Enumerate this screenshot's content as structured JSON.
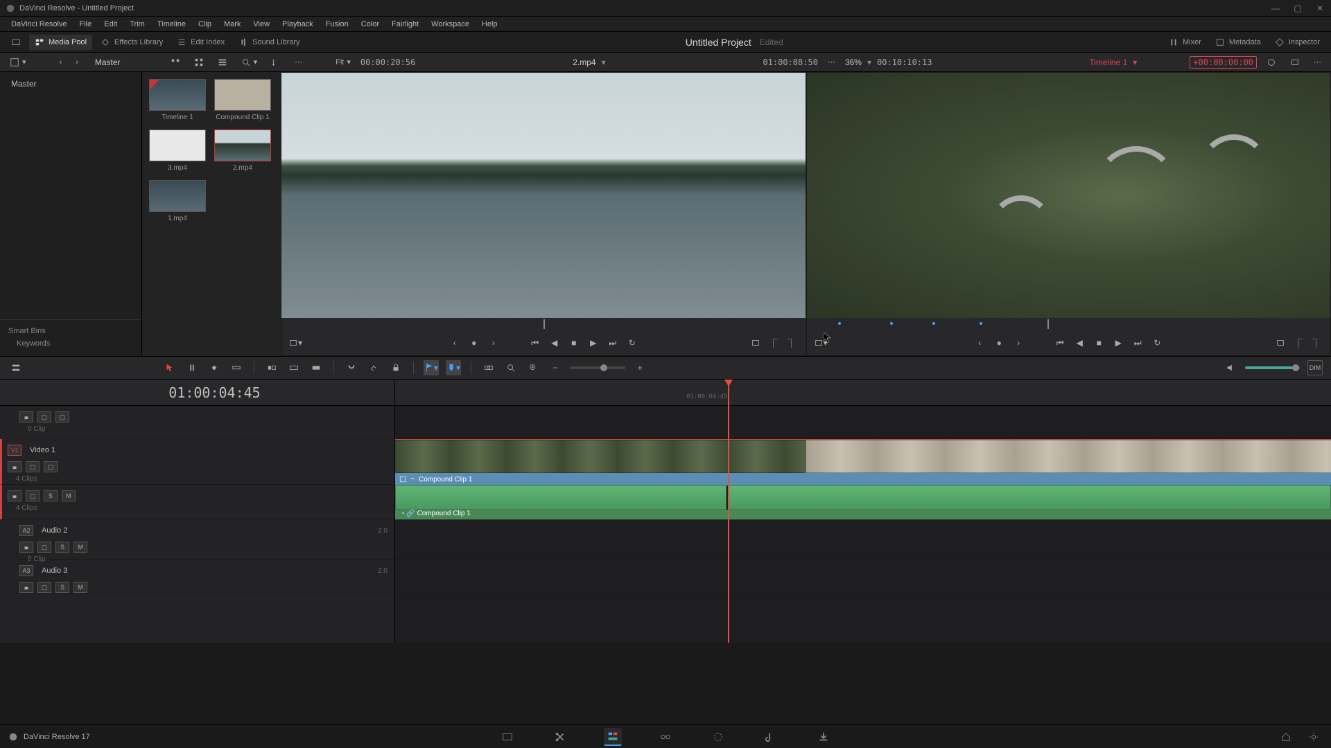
{
  "titlebar": {
    "title": "DaVinci Resolve - Untitled Project"
  },
  "menubar": [
    "DaVinci Resolve",
    "File",
    "Edit",
    "Trim",
    "Timeline",
    "Clip",
    "Mark",
    "View",
    "Playback",
    "Fusion",
    "Color",
    "Fairlight",
    "Workspace",
    "Help"
  ],
  "workspace": {
    "media_pool": "Media Pool",
    "effects_lib": "Effects Library",
    "edit_index": "Edit Index",
    "sound_lib": "Sound Library",
    "project_name": "Untitled Project",
    "edited": "Edited",
    "mixer": "Mixer",
    "metadata": "Metadata",
    "inspector": "Inspector"
  },
  "toolbar": {
    "master": "Master",
    "fit": "Fit",
    "src_tc": "00:00:20:56",
    "src_name": "2.mp4",
    "rec_tc": "01:00:08:50",
    "zoom_pct": "36%",
    "dur_tc": "00:10:10:13",
    "timeline_name": "Timeline 1",
    "offset_tc": "+00:00:00:00"
  },
  "media_pool": {
    "root": "Master",
    "smart_bins": "Smart Bins",
    "keywords": "Keywords",
    "thumbs": [
      {
        "label": "Timeline 1"
      },
      {
        "label": "Compound Clip 1"
      },
      {
        "label": "3.mp4"
      },
      {
        "label": "2.mp4"
      },
      {
        "label": "1.mp4"
      }
    ]
  },
  "timeline": {
    "position_tc": "01:00:04:45",
    "ruler_tc": "01:00:04:45",
    "tracks": {
      "v2": {
        "clips_label": "0 Clip"
      },
      "v1": {
        "name": "Video 1",
        "badge": "V1",
        "clips_label": "4 Clips",
        "clip_label": "Compound Clip 1"
      },
      "a1": {
        "clips_label": "4 Clips",
        "clip_label": "Compound Clip 1"
      },
      "a2": {
        "name": "Audio 2",
        "badge": "A2",
        "clips_label": "0 Clip",
        "ch": "2.0"
      },
      "a3": {
        "name": "Audio 3",
        "badge": "A3",
        "ch": "2.0"
      }
    },
    "btns": {
      "s": "S",
      "m": "M"
    }
  },
  "timeline_toolbar": {
    "dim": "DIM"
  },
  "bottom": {
    "version": "DaVinci Resolve 17"
  }
}
